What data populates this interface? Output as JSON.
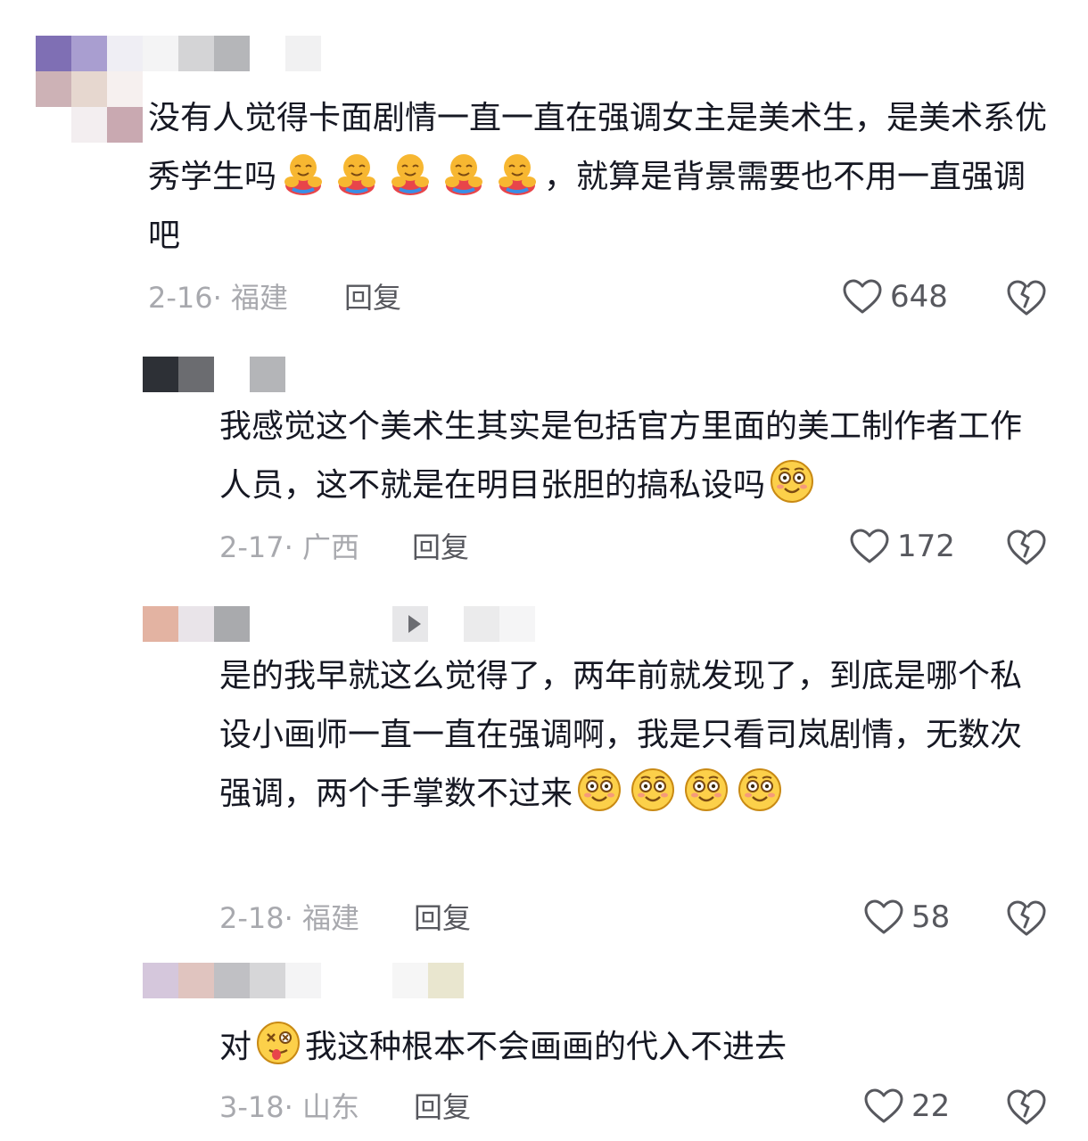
{
  "comments": [
    {
      "text_before": "没有人觉得卡面剧情一直一直在强调女主是美术生，是美术系优秀学生吗",
      "emoji": "hugging-face-emoji",
      "emoji_count": 5,
      "text_after": "，就算是背景需要也不用一直强调吧",
      "date": "2-16",
      "location": "福建",
      "reply_label": "回复",
      "likes": "648"
    },
    {
      "text_before": "我感觉这个美术生其实是包括官方里面的美工制作者工作人员，这不就是在明目张胆的搞私设吗",
      "emoji": "flushed-smile-emoji",
      "emoji_count": 1,
      "text_after": "",
      "date": "2-17",
      "location": "广西",
      "reply_label": "回复",
      "likes": "172"
    },
    {
      "text_before": "是的我早就这么觉得了，两年前就发现了，到底是哪个私设小画师一直一直在强调啊，我是只看司岚剧情，无数次强调，两个手掌数不过来",
      "emoji": "flushed-smile-emoji",
      "emoji_count": 4,
      "text_after": "",
      "date": "2-18",
      "location": "福建",
      "reply_label": "回复",
      "likes": "58"
    },
    {
      "text_before": "对",
      "emoji": "dizzy-tongue-emoji",
      "emoji_count": 1,
      "text_after": "我这种根本不会画画的代入不进去",
      "date": "3-18",
      "location": "山东",
      "reply_label": "回复",
      "likes": "22"
    }
  ],
  "colors": {
    "text": "#161823",
    "meta": "#a8a9ae",
    "action": "#57585e"
  }
}
